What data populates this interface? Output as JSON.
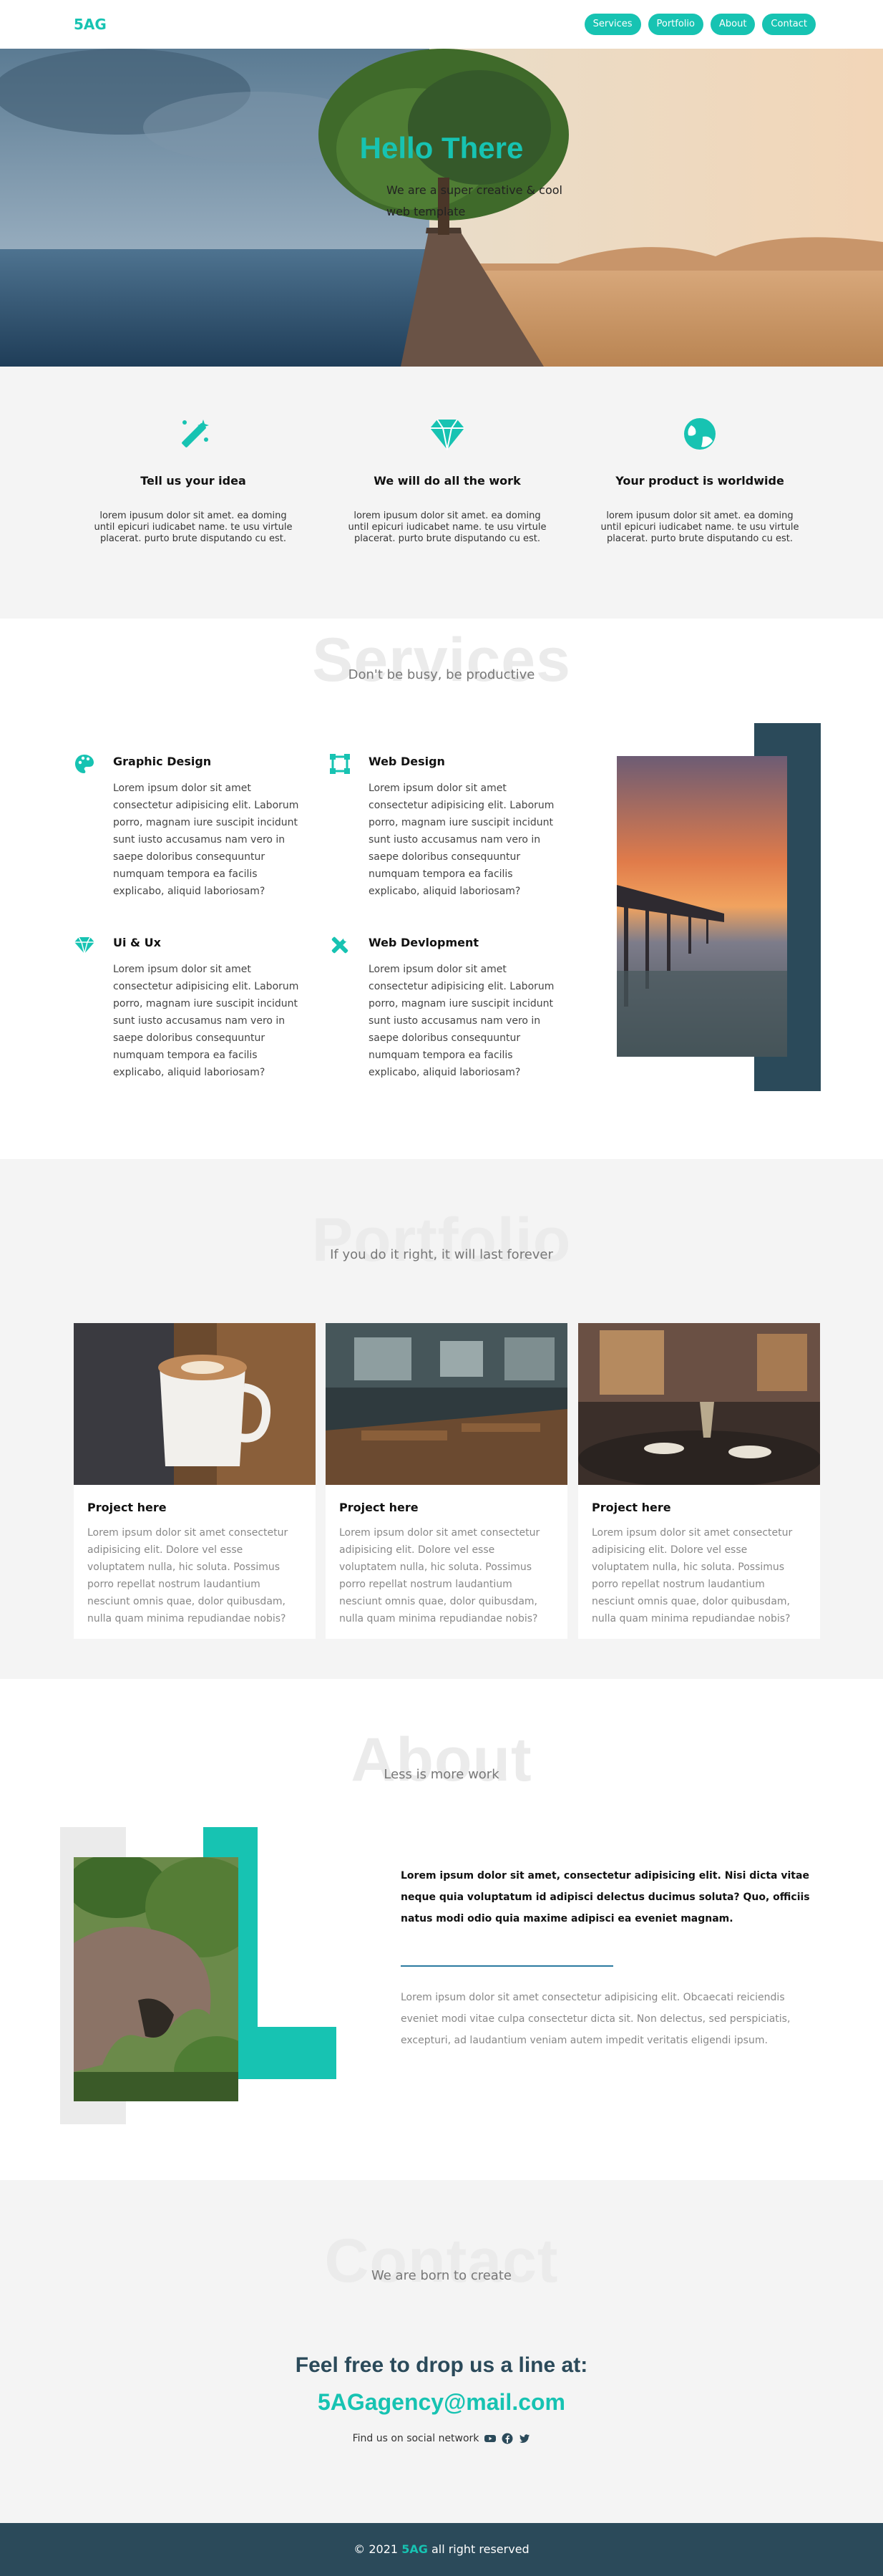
{
  "nav": {
    "logo": "5AG",
    "links": [
      "Services",
      "Portfolio",
      "About",
      "Contact"
    ]
  },
  "hero": {
    "title": "Hello There",
    "subtitle": "We are a super creative & cool web template"
  },
  "features": [
    {
      "icon": "magic-wand-icon",
      "title": "Tell us your idea",
      "text": "lorem ipusum dolor sit amet. ea doming until epicuri iudicabet name. te usu virtule placerat. purto brute disputando cu est."
    },
    {
      "icon": "diamond-icon",
      "title": "We will do all the work",
      "text": "lorem ipusum dolor sit amet. ea doming until epicuri iudicabet name. te usu virtule placerat. purto brute disputando cu est."
    },
    {
      "icon": "globe-icon",
      "title": "Your product is worldwide",
      "text": "lorem ipusum dolor sit amet. ea doming until epicuri iudicabet name. te usu virtule placerat. purto brute disputando cu est."
    }
  ],
  "services": {
    "title": "Services",
    "subtitle": "Don't be busy, be productive",
    "items": [
      {
        "icon": "palette-icon",
        "title": "Graphic Design",
        "text": "Lorem ipsum dolor sit amet consectetur adipisicing elit. Laborum porro, magnam iure suscipit incidunt sunt iusto accusamus nam vero in saepe doloribus consequuntur numquam tempora ea facilis explicabo, aliquid laboriosam?"
      },
      {
        "icon": "vector-square-icon",
        "title": "Web Design",
        "text": "Lorem ipsum dolor sit amet consectetur adipisicing elit. Laborum porro, magnam iure suscipit incidunt sunt iusto accusamus nam vero in saepe doloribus consequuntur numquam tempora ea facilis explicabo, aliquid laboriosam?"
      },
      {
        "icon": "gem-icon",
        "title": "Ui & Ux",
        "text": "Lorem ipsum dolor sit amet consectetur adipisicing elit. Laborum porro, magnam iure suscipit incidunt sunt iusto accusamus nam vero in saepe doloribus consequuntur numquam tempora ea facilis explicabo, aliquid laboriosam?"
      },
      {
        "icon": "tools-icon",
        "title": "Web Devlopment",
        "text": "Lorem ipsum dolor sit amet consectetur adipisicing elit. Laborum porro, magnam iure suscipit incidunt sunt iusto accusamus nam vero in saepe doloribus consequuntur numquam tempora ea facilis explicabo, aliquid laboriosam?"
      }
    ]
  },
  "portfolio": {
    "title": "Portfolio",
    "subtitle": "If you do it right, it will last forever",
    "projects": [
      {
        "title": "Project here",
        "text": "Lorem ipsum dolor sit amet consectetur adipisicing elit. Dolore vel esse voluptatem nulla, hic soluta. Possimus porro repellat nostrum laudantium nesciunt omnis quae, dolor quibusdam, nulla quam minima repudiandae nobis?"
      },
      {
        "title": "Project here",
        "text": "Lorem ipsum dolor sit amet consectetur adipisicing elit. Dolore vel esse voluptatem nulla, hic soluta. Possimus porro repellat nostrum laudantium nesciunt omnis quae, dolor quibusdam, nulla quam minima repudiandae nobis?"
      },
      {
        "title": "Project here",
        "text": "Lorem ipsum dolor sit amet consectetur adipisicing elit. Dolore vel esse voluptatem nulla, hic soluta. Possimus porro repellat nostrum laudantium nesciunt omnis quae, dolor quibusdam, nulla quam minima repudiandae nobis?"
      }
    ]
  },
  "about": {
    "title": "About",
    "subtitle": "Less is more work",
    "lead": "Lorem ipsum dolor sit amet, consectetur adipisicing elit. Nisi dicta vitae neque quia voluptatum id adipisci delectus ducimus soluta? Quo, officiis natus modi odio quia maxime adipisci ea eveniet magnam.",
    "body": "Lorem ipsum dolor sit amet consectetur adipisicing elit. Obcaecati reiciendis eveniet modi vitae culpa consectetur dicta sit. Non delectus, sed perspiciatis, excepturi, ad laudantium veniam autem impedit veritatis eligendi ipsum."
  },
  "contact": {
    "title": "Contact",
    "subtitle": "We are born to create",
    "heading": "Feel free to drop us a line at:",
    "email": "5AGagency@mail.com",
    "social_label": "Find us on social network",
    "social_icons": [
      "youtube-icon",
      "facebook-icon",
      "twitter-icon"
    ]
  },
  "footer": {
    "prefix": "© 2021",
    "brand": "5AG",
    "suffix": "all right reserved"
  },
  "colors": {
    "accent": "#17c3b2",
    "dark": "#2b4a5a",
    "light_bg": "#f4f4f4"
  }
}
